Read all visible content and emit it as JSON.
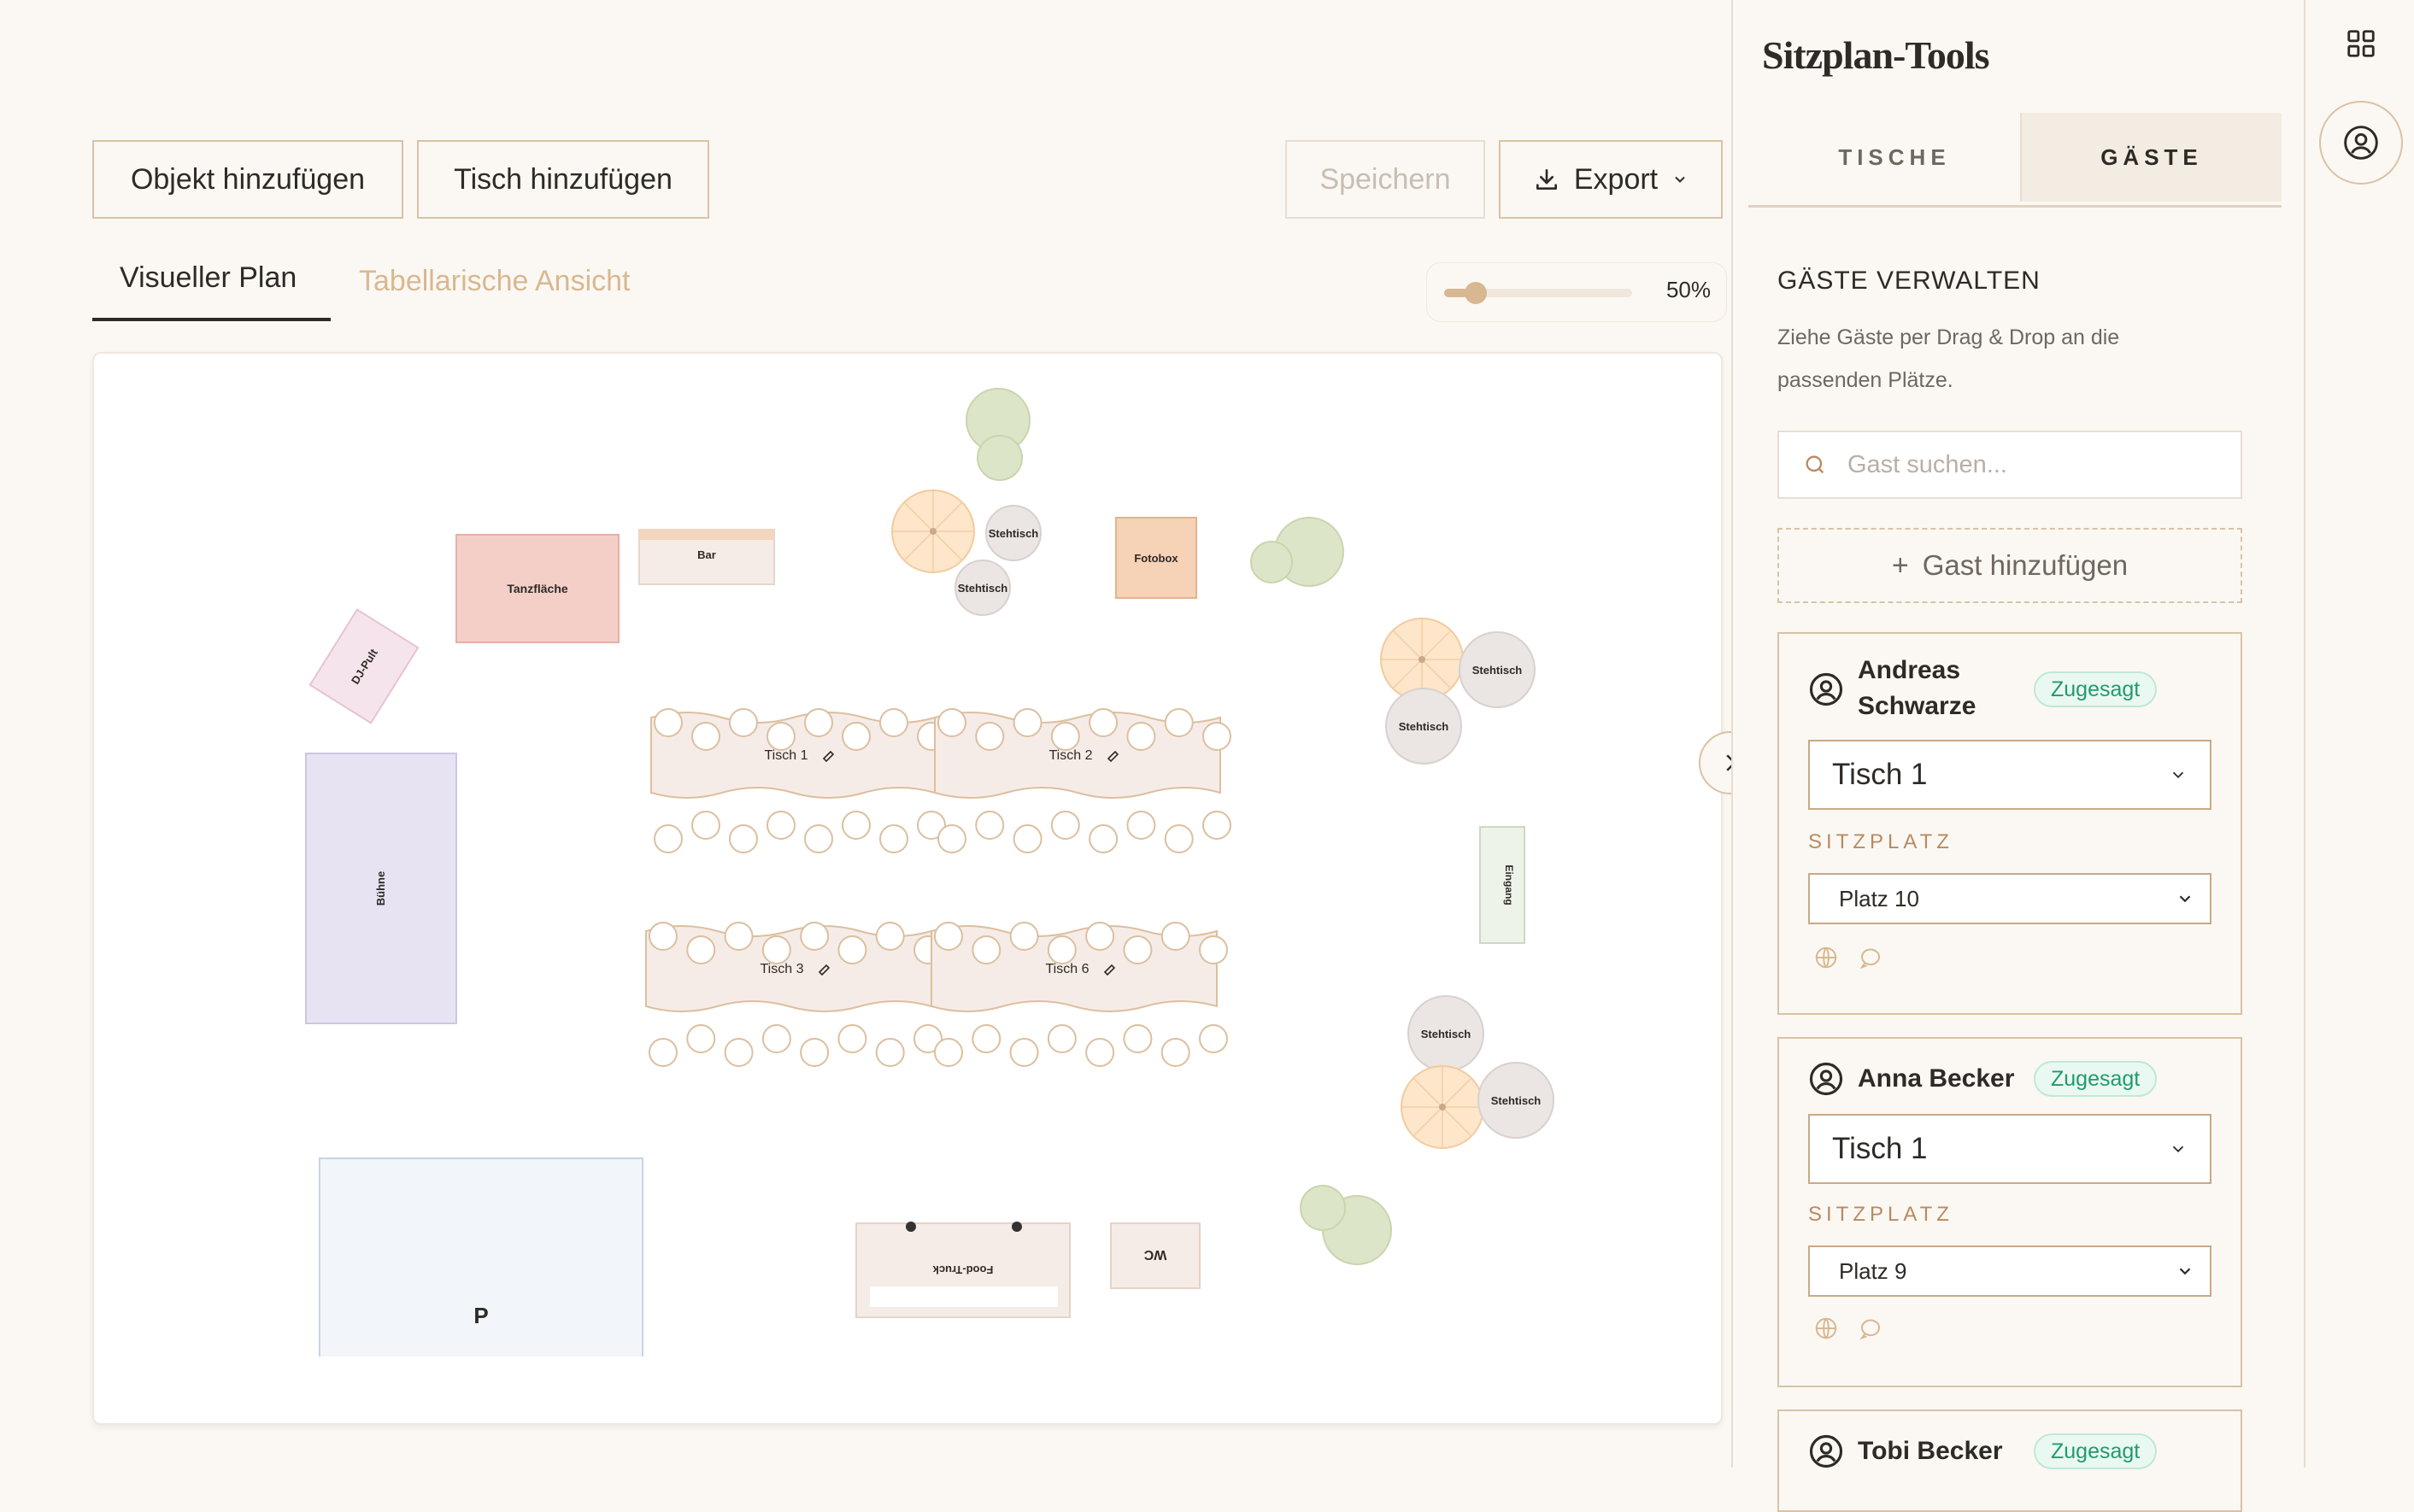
{
  "toolbar": {
    "add_object": "Objekt hinzufügen",
    "add_table": "Tisch hinzufügen",
    "save": "Speichern",
    "export": "Export"
  },
  "view_tabs": {
    "visual": "Visueller Plan",
    "table": "Tabellarische Ansicht"
  },
  "zoom": {
    "label": "50%",
    "value": 0.5
  },
  "plan": {
    "dance_floor": "Tanzfläche",
    "bar": "Bar",
    "dj": "DJ-Pult",
    "stage": "Bühne",
    "photobox": "Fotobox",
    "standing_table": "Stehtisch",
    "entrance": "Eingang",
    "parking": "P",
    "food_truck": "Food-Truck",
    "wc": "WC",
    "tables": [
      "Tisch 1",
      "Tisch 2",
      "Tisch 3",
      "Tisch 6"
    ]
  },
  "panel": {
    "title": "Sitzplan-Tools",
    "tabs": [
      "TISCHE",
      "GÄSTE"
    ],
    "section_title": "GÄSTE VERWALTEN",
    "section_desc": "Ziehe Gäste per Drag & Drop an die passenden Plätze.",
    "search_placeholder": "Gast suchen...",
    "add_guest": "Gast hinzufügen",
    "seat_label": "SITZPLATZ",
    "guests": [
      {
        "name_line1": "Andreas",
        "name_line2": "Schwarze",
        "status": "Zugesagt",
        "table": "Tisch 1",
        "seat": "Platz 10"
      },
      {
        "name_line1": "Anna Becker",
        "status": "Zugesagt",
        "table": "Tisch 1",
        "seat": "Platz 9"
      },
      {
        "name_line1": "Tobi Becker",
        "status": "Zugesagt"
      }
    ]
  }
}
